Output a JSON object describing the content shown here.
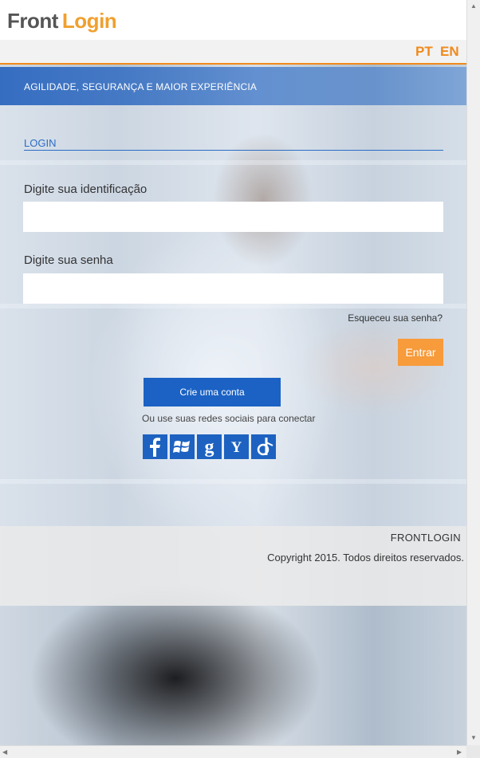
{
  "brand": {
    "logo_part1": "Front",
    "logo_part2": "Login"
  },
  "language": {
    "pt": "PT",
    "en": "EN"
  },
  "banner": {
    "tagline": "AGILIDADE, SEGURANÇA E MAIOR EXPERIÊNCIA"
  },
  "login": {
    "title": "LOGIN",
    "id_label": "Digite sua identificação",
    "id_value": "",
    "password_label": "Digite sua senha",
    "password_value": "",
    "forgot_link": "Esqueceu sua senha?",
    "submit_label": "Entrar",
    "create_account_label": "Crie uma conta",
    "social_prompt": "Ou use suas redes sociais para conectar",
    "social_icons": [
      "facebook-icon",
      "windows-icon",
      "google-icon",
      "yahoo-icon",
      "openid-icon"
    ]
  },
  "footer": {
    "brand": "FRONTLOGIN",
    "copyright": "Copyright 2015. Todos direitos reservados."
  },
  "colors": {
    "accent_orange": "#f08a1c",
    "button_orange": "#f79b3b",
    "primary_blue": "#1b62c4",
    "banner_blue": "#2864be"
  }
}
